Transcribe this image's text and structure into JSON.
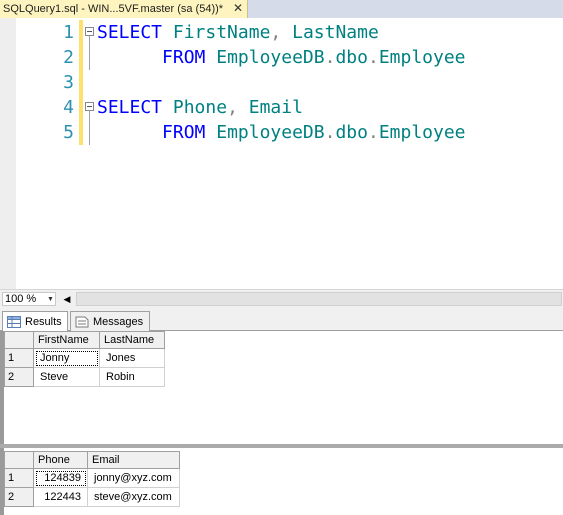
{
  "document_tab": {
    "title": "SQLQuery1.sql - WIN...5VF.master (sa (54))*",
    "close_glyph": "✕"
  },
  "editor": {
    "lines": [
      {
        "number": "1",
        "has_fold": true,
        "tokens": [
          {
            "t": "kw",
            "v": "SELECT"
          },
          {
            "t": "sp",
            "v": " "
          },
          {
            "t": "id",
            "v": "FirstName"
          },
          {
            "t": "pu",
            "v": ","
          },
          {
            "t": "sp",
            "v": " "
          },
          {
            "t": "id",
            "v": "LastName"
          }
        ]
      },
      {
        "number": "2",
        "has_fold": false,
        "tokens": [
          {
            "t": "sp",
            "v": "      "
          },
          {
            "t": "kw",
            "v": "FROM"
          },
          {
            "t": "sp",
            "v": " "
          },
          {
            "t": "id",
            "v": "EmployeeDB"
          },
          {
            "t": "pu",
            "v": "."
          },
          {
            "t": "id",
            "v": "dbo"
          },
          {
            "t": "pu",
            "v": "."
          },
          {
            "t": "id",
            "v": "Employee"
          }
        ]
      },
      {
        "number": "3",
        "has_fold": false,
        "tokens": []
      },
      {
        "number": "4",
        "has_fold": true,
        "tokens": [
          {
            "t": "kw",
            "v": "SELECT"
          },
          {
            "t": "sp",
            "v": " "
          },
          {
            "t": "id",
            "v": "Phone"
          },
          {
            "t": "pu",
            "v": ","
          },
          {
            "t": "sp",
            "v": " "
          },
          {
            "t": "id",
            "v": "Email"
          }
        ]
      },
      {
        "number": "5",
        "has_fold": false,
        "tokens": [
          {
            "t": "sp",
            "v": "      "
          },
          {
            "t": "kw",
            "v": "FROM"
          },
          {
            "t": "sp",
            "v": " "
          },
          {
            "t": "id",
            "v": "EmployeeDB"
          },
          {
            "t": "pu",
            "v": "."
          },
          {
            "t": "id",
            "v": "dbo"
          },
          {
            "t": "pu",
            "v": "."
          },
          {
            "t": "id",
            "v": "Employee"
          }
        ]
      }
    ]
  },
  "zoom": {
    "value": "100 %",
    "arrow": "▼"
  },
  "scroll": {
    "left_arrow": "◀"
  },
  "results_tabs": [
    {
      "label": "Results",
      "active": true
    },
    {
      "label": "Messages",
      "active": false
    }
  ],
  "result_sets": [
    {
      "columns": [
        "FirstName",
        "LastName"
      ],
      "rows": [
        {
          "num": "1",
          "cells": [
            "Jonny",
            "Jones"
          ]
        },
        {
          "num": "2",
          "cells": [
            "Steve",
            "Robin"
          ]
        }
      ]
    },
    {
      "columns": [
        "Phone",
        "Email"
      ],
      "rows": [
        {
          "num": "1",
          "cells": [
            "124839",
            "jonny@xyz.com"
          ]
        },
        {
          "num": "2",
          "cells": [
            "122443",
            "steve@xyz.com"
          ]
        }
      ]
    }
  ]
}
